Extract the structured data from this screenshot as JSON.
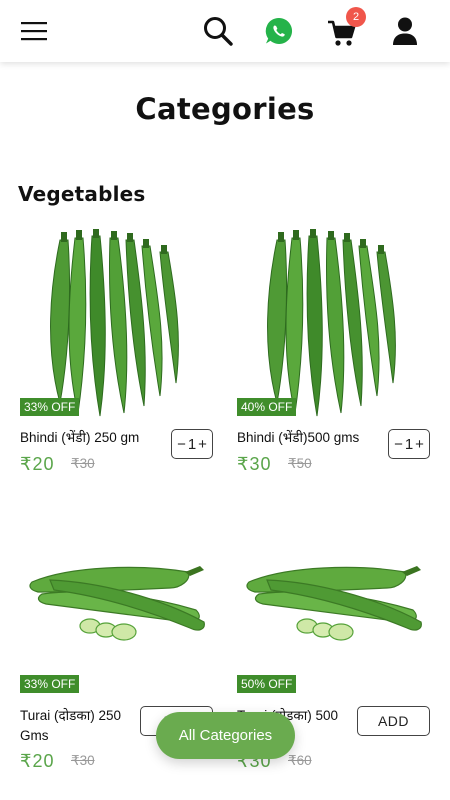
{
  "header": {
    "cart_count": "2",
    "icons": [
      "menu-icon",
      "search-icon",
      "whatsapp-icon",
      "cart-icon",
      "user-icon"
    ],
    "colors": {
      "whatsapp": "#25b34a",
      "badge": "#f0564b"
    }
  },
  "page": {
    "title": "Categories"
  },
  "section": {
    "title": "Vegetables"
  },
  "products": [
    {
      "discount": "33% OFF",
      "name": "Bhindi (भेंडी) 250 gm",
      "price": "₹20",
      "mrp": "₹30",
      "control": "stepper",
      "minus": "−",
      "qty": "1",
      "plus": "+"
    },
    {
      "discount": "40% OFF",
      "name": "Bhindi (भेंडी)500 gms",
      "price": "₹30",
      "mrp": "₹50",
      "control": "stepper",
      "minus": "−",
      "qty": "1",
      "plus": "+"
    },
    {
      "discount": "33% OFF",
      "name_line1": "Turai (दोडका) 250",
      "name_line2": "Gms",
      "price": "₹20",
      "mrp": "₹30",
      "control": "add",
      "add_label": "ADD"
    },
    {
      "discount": "50% OFF",
      "name_line1": "Turai (दोडका) 500",
      "price": "₹30",
      "mrp": "₹60",
      "control": "add",
      "add_label": "ADD"
    }
  ],
  "floating": {
    "label": "All Categories"
  },
  "colors": {
    "accent_green": "#5aa54a",
    "badge_green": "#3f8d2b",
    "button_green": "#6aab4f"
  }
}
